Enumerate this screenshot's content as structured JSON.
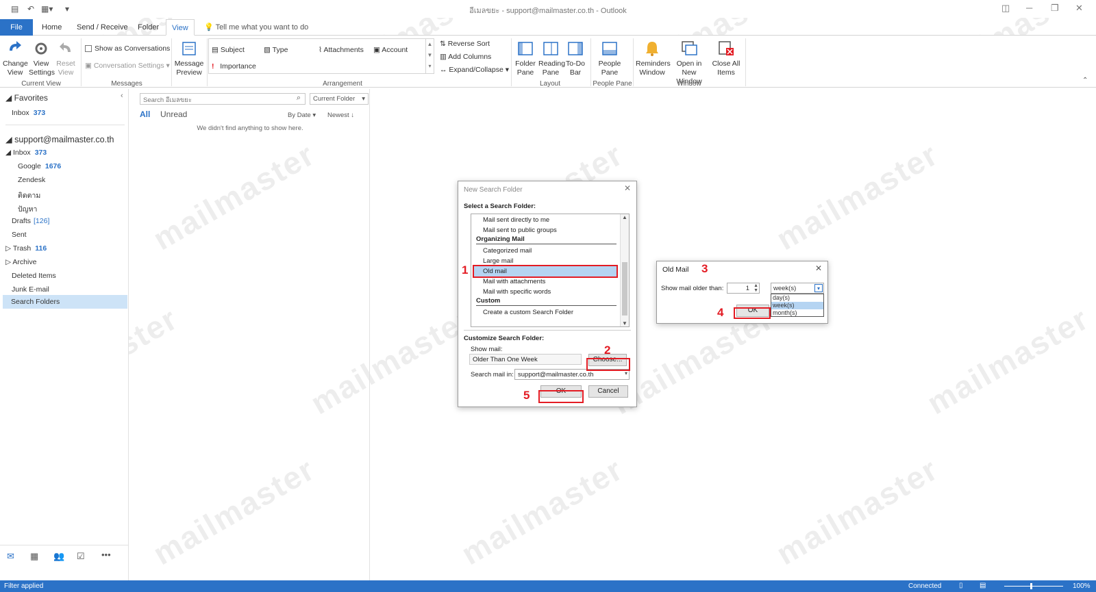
{
  "window": {
    "title": "อีเมลขยะ - support@mailmaster.co.th  -  Outlook"
  },
  "ribbon_tabs": [
    "File",
    "Home",
    "Send / Receive",
    "Folder",
    "View"
  ],
  "tell_me": "Tell me what you want to do",
  "ribbon": {
    "current_view": {
      "change_view": "Change View",
      "view_settings": "View Settings",
      "reset_view": "Reset View",
      "label": "Current View"
    },
    "messages": {
      "show_as_conversations": "Show as Conversations",
      "conversation_settings": "Conversation Settings",
      "label": "Messages"
    },
    "message_preview": "Message Preview",
    "arrangement": {
      "subject": "Subject",
      "type": "Type",
      "attachments": "Attachments",
      "account": "Account",
      "importance": "Importance",
      "reverse_sort": "Reverse Sort",
      "add_columns": "Add Columns",
      "expand_collapse": "Expand/Collapse",
      "label": "Arrangement"
    },
    "layout": {
      "folder_pane": "Folder Pane",
      "reading_pane": "Reading Pane",
      "todo_bar": "To-Do Bar",
      "label": "Layout"
    },
    "people_pane": {
      "people_pane": "People Pane",
      "label": "People Pane"
    },
    "window": {
      "reminders": "Reminders Window",
      "open_new": "Open in New Window",
      "close_all": "Close All Items",
      "label": "Window"
    }
  },
  "nav": {
    "favorites": "Favorites",
    "fav_inbox": "Inbox",
    "fav_inbox_count": "373",
    "account": "support@mailmaster.co.th",
    "inbox": "Inbox",
    "inbox_count": "373",
    "google": "Google",
    "google_count": "1676",
    "zendesk": "Zendesk",
    "follow": "ติดตาม",
    "problem": "ปัญหา",
    "drafts": "Drafts",
    "drafts_count": "[126]",
    "sent": "Sent",
    "trash": "Trash",
    "trash_count": "116",
    "archive": "Archive",
    "deleted": "Deleted Items",
    "junk": "Junk E-mail",
    "search_folders": "Search Folders"
  },
  "list": {
    "search_placeholder": "Search อีเมลขยะ",
    "scope": "Current Folder",
    "filter_all": "All",
    "filter_unread": "Unread",
    "sort_by": "By Date",
    "order": "Newest",
    "empty": "We didn't find anything to show here."
  },
  "new_search_folder": {
    "title": "New Search Folder",
    "select_label": "Select a Search Folder:",
    "items": [
      "Mail sent directly to me",
      "Mail sent to public groups"
    ],
    "header_organizing": "Organizing Mail",
    "org_items": [
      "Categorized mail",
      "Large mail",
      "Old mail",
      "Mail with attachments",
      "Mail with specific words"
    ],
    "header_custom": "Custom",
    "custom_items": [
      "Create a custom Search Folder"
    ],
    "customize_label": "Customize Search Folder:",
    "show_mail_label": "Show mail:",
    "show_mail_value": "Older Than One Week",
    "choose": "Choose...",
    "search_in_label": "Search mail in:",
    "search_in_value": "support@mailmaster.co.th",
    "ok": "OK",
    "cancel": "Cancel"
  },
  "old_mail": {
    "title": "Old Mail",
    "label": "Show mail older than:",
    "number": "1",
    "unit": "week(s)",
    "options": [
      "day(s)",
      "week(s)",
      "month(s)"
    ],
    "ok": "OK"
  },
  "steps": [
    "1",
    "2",
    "3",
    "4",
    "5"
  ],
  "watermark": "mailmaster",
  "status": {
    "filter": "Filter applied",
    "connected": "Connected",
    "zoom": "100%"
  },
  "colors": {
    "accent": "#2b72c7",
    "highlight": "#b5d4f2",
    "annotation": "#e31b23"
  }
}
